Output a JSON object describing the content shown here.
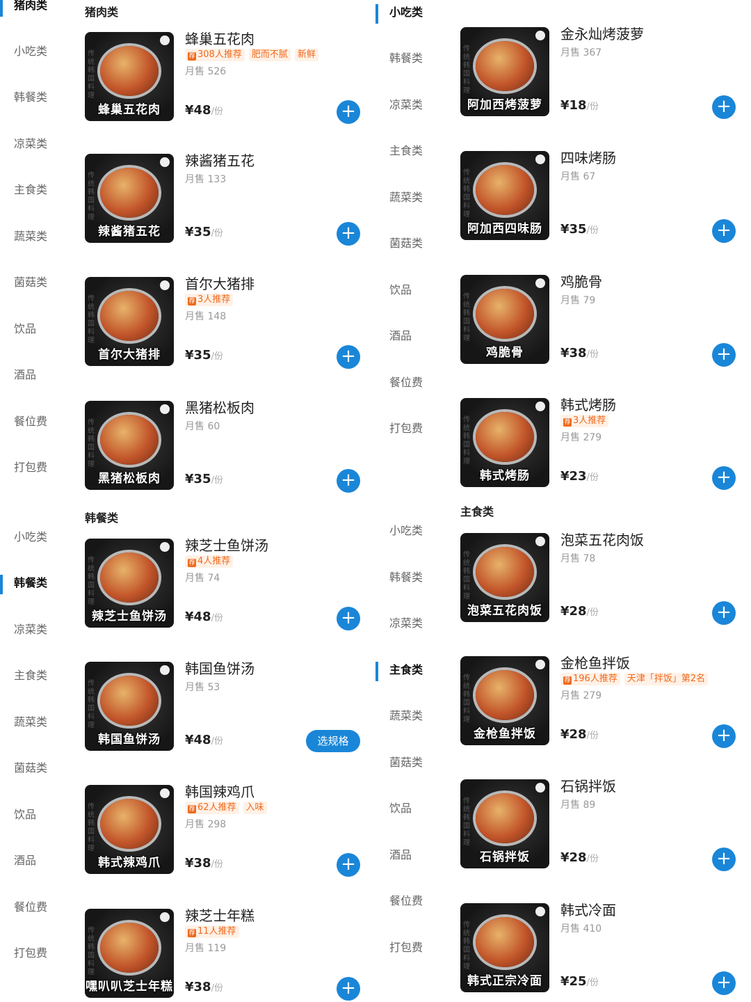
{
  "theme": {
    "accent": "#1a86d8",
    "tag_orange": "#f06a1d"
  },
  "left_panel": {
    "sidebar_a": [
      {
        "label": "猪肉类",
        "active": true
      },
      {
        "label": "小吃类"
      },
      {
        "label": "韩餐类"
      },
      {
        "label": "凉菜类"
      },
      {
        "label": "主食类"
      },
      {
        "label": "蔬菜类"
      },
      {
        "label": "菌菇类"
      },
      {
        "label": "饮品"
      },
      {
        "label": "酒品"
      },
      {
        "label": "餐位费"
      },
      {
        "label": "打包费"
      }
    ],
    "sidebar_b": [
      {
        "label": "小吃类"
      },
      {
        "label": "韩餐类",
        "active": true
      },
      {
        "label": "凉菜类"
      },
      {
        "label": "主食类"
      },
      {
        "label": "蔬菜类"
      },
      {
        "label": "菌菇类"
      },
      {
        "label": "饮品"
      },
      {
        "label": "酒品"
      },
      {
        "label": "餐位费"
      },
      {
        "label": "打包费"
      }
    ],
    "section_1": "猪肉类",
    "section_2": "韩餐类",
    "products": [
      {
        "name": "蜂巢五花肉",
        "caption": "蜂巢五花肉",
        "tags": [
          "308人推荐",
          "肥而不腻",
          "新鲜"
        ],
        "sales": "月售 526",
        "price": "¥48",
        "unit": "/份",
        "action": "add"
      },
      {
        "name": "辣酱猪五花",
        "caption": "辣酱猪五花",
        "tags": [],
        "sales": "月售 133",
        "price": "¥35",
        "unit": "/份",
        "action": "add"
      },
      {
        "name": "首尔大猪排",
        "caption": "首尔大猪排",
        "tags": [
          "3人推荐"
        ],
        "sales": "月售 148",
        "price": "¥35",
        "unit": "/份",
        "action": "add"
      },
      {
        "name": "黑猪松板肉",
        "caption": "黑猪松板肉",
        "tags": [],
        "sales": "月售 60",
        "price": "¥35",
        "unit": "/份",
        "action": "add"
      },
      {
        "name": "辣芝士鱼饼汤",
        "caption": "辣芝士鱼饼汤",
        "tags": [
          "4人推荐"
        ],
        "sales": "月售 74",
        "price": "¥48",
        "unit": "/份",
        "action": "add"
      },
      {
        "name": "韩国鱼饼汤",
        "caption": "韩国鱼饼汤",
        "tags": [],
        "sales": "月售 53",
        "price": "¥48",
        "unit": "/份",
        "action": "spec",
        "spec_label": "选规格"
      },
      {
        "name": "韩国辣鸡爪",
        "caption": "韩式辣鸡爪",
        "tags": [
          "62人推荐",
          "入味"
        ],
        "sales": "月售 298",
        "price": "¥38",
        "unit": "/份",
        "action": "add"
      },
      {
        "name": "辣芝士年糕",
        "caption": "嘿叭叭芝士年糕",
        "tags": [
          "11人推荐"
        ],
        "sales": "月售 119",
        "price": "¥38",
        "unit": "/份",
        "action": "add"
      }
    ]
  },
  "right_panel": {
    "sidebar_a": [
      {
        "label": "小吃类",
        "active": true
      },
      {
        "label": "韩餐类"
      },
      {
        "label": "凉菜类"
      },
      {
        "label": "主食类"
      },
      {
        "label": "蔬菜类"
      },
      {
        "label": "菌菇类"
      },
      {
        "label": "饮品"
      },
      {
        "label": "酒品"
      },
      {
        "label": "餐位费"
      },
      {
        "label": "打包费"
      }
    ],
    "sidebar_b": [
      {
        "label": "小吃类"
      },
      {
        "label": "韩餐类"
      },
      {
        "label": "凉菜类"
      },
      {
        "label": "主食类",
        "active": true
      },
      {
        "label": "蔬菜类"
      },
      {
        "label": "菌菇类"
      },
      {
        "label": "饮品"
      },
      {
        "label": "酒品"
      },
      {
        "label": "餐位费"
      },
      {
        "label": "打包费"
      }
    ],
    "section_2": "主食类",
    "products": [
      {
        "name": "金永灿烤菠萝",
        "caption": "阿加西烤菠萝",
        "tags": [],
        "sales": "月售 367",
        "price": "¥18",
        "unit": "/份",
        "action": "add"
      },
      {
        "name": "四味烤肠",
        "caption": "阿加西四味肠",
        "tags": [],
        "sales": "月售 67",
        "price": "¥35",
        "unit": "/份",
        "action": "add"
      },
      {
        "name": "鸡脆骨",
        "caption": "鸡脆骨",
        "tags": [],
        "sales": "月售 79",
        "price": "¥38",
        "unit": "/份",
        "action": "add"
      },
      {
        "name": "韩式烤肠",
        "caption": "韩式烤肠",
        "tags": [
          "3人推荐"
        ],
        "sales": "月售 279",
        "price": "¥23",
        "unit": "/份",
        "action": "add"
      },
      {
        "name": "泡菜五花肉饭",
        "caption": "泡菜五花肉饭",
        "tags": [],
        "sales": "月售 78",
        "price": "¥28",
        "unit": "/份",
        "action": "add"
      },
      {
        "name": "金枪鱼拌饭",
        "caption": "金枪鱼拌饭",
        "tags": [
          "196人推荐",
          "天津「拌饭」第2名"
        ],
        "sales": "月售 279",
        "price": "¥28",
        "unit": "/份",
        "action": "add"
      },
      {
        "name": "石锅拌饭",
        "caption": "石锅拌饭",
        "tags": [],
        "sales": "月售 89",
        "price": "¥28",
        "unit": "/份",
        "action": "add"
      },
      {
        "name": "韩式冷面",
        "caption": "韩式正宗冷面",
        "tags": [],
        "sales": "月售 410",
        "price": "¥25",
        "unit": "/份",
        "action": "add"
      }
    ]
  },
  "thumb_side_text": "传统韩国料理"
}
